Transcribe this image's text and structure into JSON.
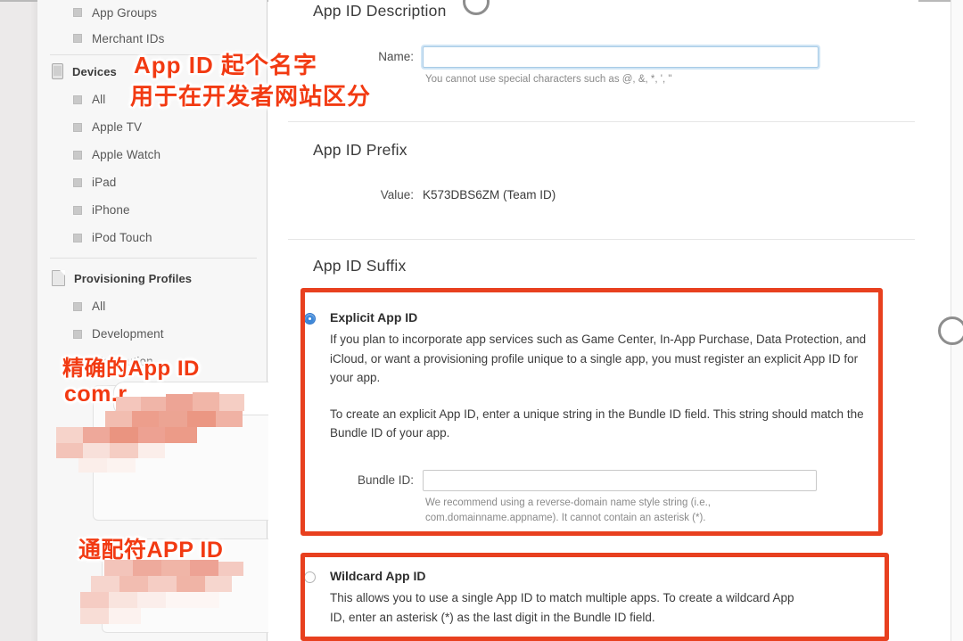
{
  "window": {
    "scrollbar_present": true
  },
  "sidebar": {
    "items": [
      {
        "label": "App Groups",
        "type": "child"
      },
      {
        "label": "Merchant IDs",
        "type": "child"
      },
      {
        "label": "Devices",
        "type": "group",
        "icon": "device-icon"
      },
      {
        "label": "All",
        "type": "child"
      },
      {
        "label": "Apple TV",
        "type": "child"
      },
      {
        "label": "Apple Watch",
        "type": "child"
      },
      {
        "label": "iPad",
        "type": "child"
      },
      {
        "label": "iPhone",
        "type": "child"
      },
      {
        "label": "iPod Touch",
        "type": "child"
      },
      {
        "label": "Provisioning Profiles",
        "type": "group",
        "icon": "document-icon"
      },
      {
        "label": "All",
        "type": "child"
      },
      {
        "label": "Development",
        "type": "child"
      },
      {
        "label": "Distribution",
        "type": "child"
      }
    ]
  },
  "main": {
    "description_section": {
      "title": "App ID Description",
      "name_label": "Name:",
      "name_value": "",
      "name_placeholder": "",
      "name_hint": "You cannot use special characters such as @, &, *, ', \""
    },
    "prefix_section": {
      "title": "App ID Prefix",
      "value_label": "Value:",
      "value": "K573DBS6ZM (Team ID)"
    },
    "suffix_section": {
      "title": "App ID Suffix",
      "explicit": {
        "selected": true,
        "title": "Explicit App ID",
        "paragraph_1": "If you plan to incorporate app services such as Game Center, In-App Purchase, Data Protection, and iCloud, or want a provisioning profile unique to a single app, you must register an explicit App ID for your app.",
        "paragraph_2": "To create an explicit App ID, enter a unique string in the Bundle ID field. This string should match the Bundle ID of your app.",
        "bundle_label": "Bundle ID:",
        "bundle_value": "",
        "bundle_hint_line_1": "We recommend using a reverse-domain name style string (i.e.,",
        "bundle_hint_line_2": "com.domainname.appname). It cannot contain an asterisk (*)."
      },
      "wildcard": {
        "selected": false,
        "title": "Wildcard App ID",
        "paragraph_line_1": "This allows you to use a single App ID to match multiple apps. To create a wildcard App",
        "paragraph_line_2": "ID, enter an asterisk (*) as the last digit in the Bundle ID field."
      }
    }
  },
  "annotations": {
    "accent_color": "#f23a12",
    "box_color": "#e8401f",
    "top": {
      "line_1": "App ID 起个名字",
      "line_2": "用于在开发者网站区分"
    },
    "explicit_label": {
      "line_1": "精确的App ID",
      "line_2": "com.r"
    },
    "wildcard_label": {
      "line_1": "通配符APP ID"
    }
  }
}
